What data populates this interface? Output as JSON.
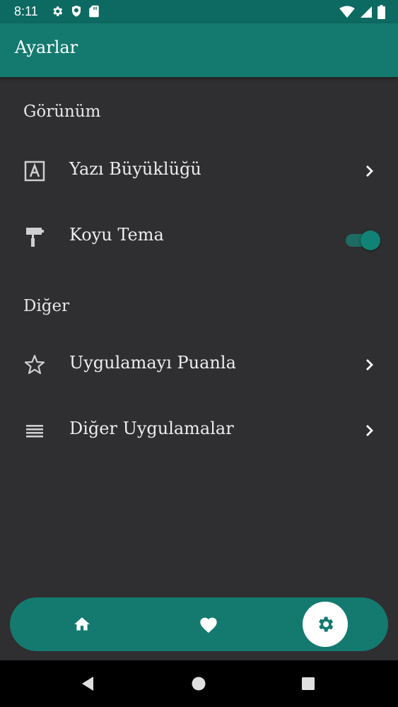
{
  "status_bar": {
    "time": "8:11",
    "left_icons": [
      "gear-icon",
      "shield-icon",
      "sd-card-icon"
    ],
    "right_icons": [
      "wifi-icon",
      "signal-icon",
      "battery-icon"
    ]
  },
  "app_bar": {
    "title": "Ayarlar"
  },
  "sections": [
    {
      "header": "Görünüm",
      "items": [
        {
          "label": "Yazı Büyüklüğü",
          "icon": "font-size-icon",
          "control": "chevron"
        },
        {
          "label": "Koyu Tema",
          "icon": "paint-roller-icon",
          "control": "toggle",
          "toggle_on": true
        }
      ]
    },
    {
      "header": "Diğer",
      "items": [
        {
          "label": "Uygulamayı Puanla",
          "icon": "star-icon",
          "control": "chevron"
        },
        {
          "label": "Diğer Uygulamalar",
          "icon": "list-icon",
          "control": "chevron"
        }
      ]
    }
  ],
  "bottom_nav": {
    "items": [
      "home-icon",
      "heart-icon",
      "settings-icon"
    ],
    "active": "settings-icon"
  },
  "colors": {
    "accent": "#147a70",
    "status_bar": "#0d6a62",
    "background": "#2f2e30"
  },
  "system_nav": [
    "back-icon",
    "home-circle-icon",
    "recents-icon"
  ]
}
